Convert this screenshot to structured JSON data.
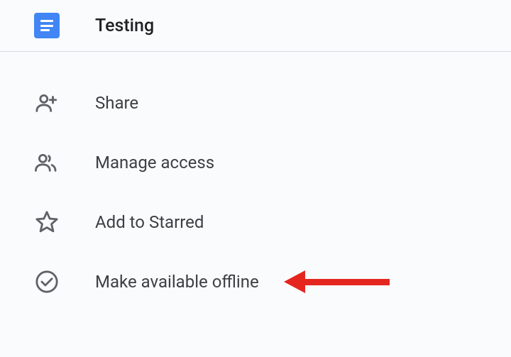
{
  "header": {
    "title": "Testing"
  },
  "menu": {
    "items": [
      {
        "label": "Share"
      },
      {
        "label": "Manage access"
      },
      {
        "label": "Add to Starred"
      },
      {
        "label": "Make available offline"
      }
    ]
  }
}
